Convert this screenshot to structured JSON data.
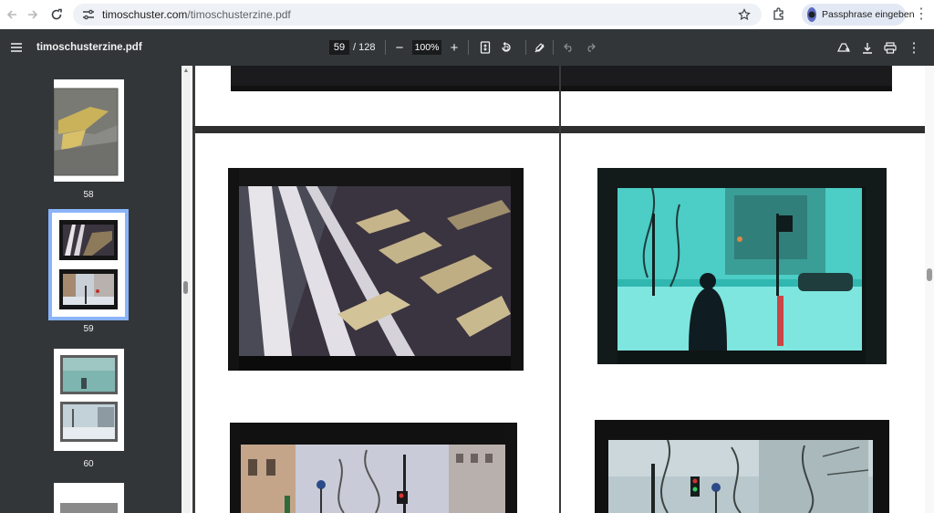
{
  "browser": {
    "url_host": "timoschuster.com",
    "url_path": "/timoschusterzine.pdf",
    "profile_label": "Passphrase eingeben",
    "icons": [
      "back-icon",
      "forward-icon",
      "reload-icon",
      "site-info-icon",
      "bookmark-star-icon",
      "extensions-icon",
      "profile-avatar-icon",
      "browser-menu-icon"
    ]
  },
  "pdf_toolbar": {
    "title": "timoschusterzine.pdf",
    "current_page": "59",
    "total_pages": "/ 128",
    "zoom": "100%",
    "zoom_out": "−",
    "zoom_in": "+",
    "icons": [
      "menu-icon",
      "fit-page-icon",
      "rotate-icon",
      "annotate-icon",
      "undo-icon",
      "redo-icon",
      "drive-save-icon",
      "download-icon",
      "print-icon",
      "more-options-icon"
    ]
  },
  "sidebar": {
    "thumbnails": [
      {
        "page": "58"
      },
      {
        "page": "59",
        "selected": true
      },
      {
        "page": "60"
      }
    ]
  },
  "colors": {
    "toolbar_bg": "#323639",
    "selection_outline": "#8ab4f8",
    "omnibox_bg": "#eef1f6",
    "profile_chip_bg": "#e3e9f4"
  }
}
